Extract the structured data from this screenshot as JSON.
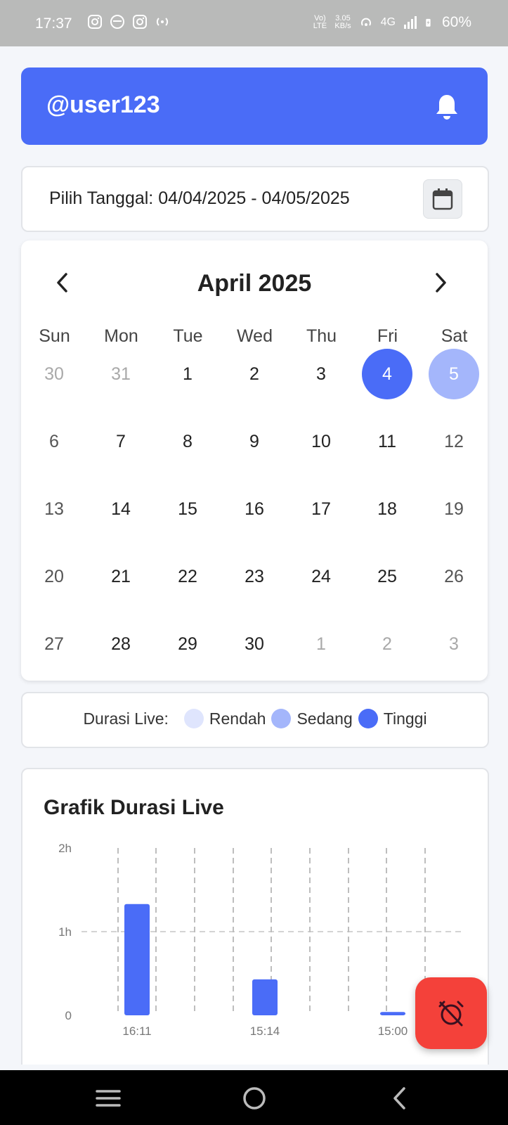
{
  "status_bar": {
    "time": "17:37",
    "network_speed_value": "3.05",
    "network_speed_unit": "KB/s",
    "volte": "Vo) LTE",
    "network_type": "4G",
    "battery": "60%"
  },
  "header": {
    "username": "@user123"
  },
  "date_range": {
    "label": "Pilih Tanggal: 04/04/2025 - 04/05/2025"
  },
  "calendar": {
    "month_title": "April 2025",
    "weekdays": [
      "Sun",
      "Mon",
      "Tue",
      "Wed",
      "Thu",
      "Fri",
      "Sat"
    ],
    "weeks": [
      [
        "30",
        "31",
        "1",
        "2",
        "3",
        "4",
        "5"
      ],
      [
        "6",
        "7",
        "8",
        "9",
        "10",
        "11",
        "12"
      ],
      [
        "13",
        "14",
        "15",
        "16",
        "17",
        "18",
        "19"
      ],
      [
        "20",
        "21",
        "22",
        "23",
        "24",
        "25",
        "26"
      ],
      [
        "27",
        "28",
        "29",
        "30",
        "1",
        "2",
        "3"
      ]
    ],
    "muted_days": [
      [
        0,
        0
      ],
      [
        0,
        1
      ],
      [
        4,
        4
      ],
      [
        4,
        5
      ],
      [
        4,
        6
      ]
    ],
    "selected_high": [
      0,
      5
    ],
    "selected_mid": [
      0,
      6
    ]
  },
  "legend": {
    "title": "Durasi Live:",
    "items": [
      {
        "label": "Rendah",
        "color": "#dfe5fd"
      },
      {
        "label": "Sedang",
        "color": "#a4b6fb"
      },
      {
        "label": "Tinggi",
        "color": "#4a6cf7"
      }
    ]
  },
  "chart": {
    "title": "Grafik Durasi Live",
    "y_ticks": [
      "2h",
      "1h",
      "0"
    ]
  },
  "chart_data": {
    "type": "bar",
    "title": "Grafik Durasi Live",
    "categories": [
      "16:11",
      "15:14",
      "15:00"
    ],
    "values": [
      1.33,
      0.43,
      0.04
    ],
    "ylabel": "",
    "xlabel": "",
    "y_unit": "hours",
    "ylim": [
      0,
      2
    ],
    "y_tick_labels": [
      "0",
      "1h",
      "2h"
    ],
    "grid": true,
    "bar_color": "#4a6cf7"
  },
  "colors": {
    "accent": "#4a6cf7",
    "fab": "#f4413a"
  },
  "icons": {
    "bell": "bell-icon",
    "calendar": "calendar-icon",
    "fab": "alarm-off-icon"
  }
}
